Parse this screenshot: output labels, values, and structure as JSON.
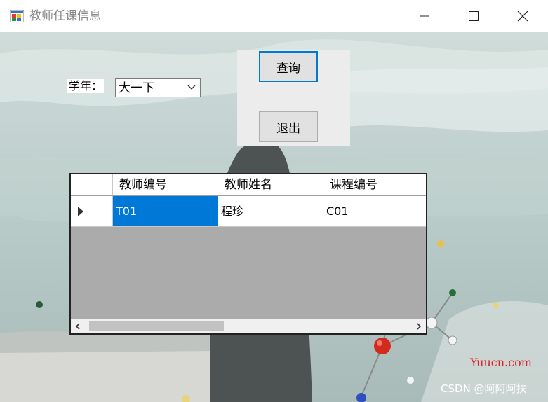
{
  "window": {
    "title": "教师任课信息",
    "icons": {
      "app": "app-window-icon",
      "minimize": "minimize-icon",
      "maximize": "maximize-icon",
      "close": "close-icon"
    }
  },
  "form": {
    "year_label": "学年：",
    "year_combo": {
      "value": "大一下"
    },
    "query_button": "查询",
    "exit_button": "退出"
  },
  "grid": {
    "columns": [
      "教师编号",
      "教师姓名",
      "课程编号"
    ],
    "rows": [
      {
        "teacher_id": "T01",
        "teacher_name": "程珍",
        "course_id": "C01",
        "selected_cell": "teacher_id"
      }
    ],
    "scrollbar": {
      "thumb_position": 0.0
    }
  },
  "watermarks": {
    "site": "Yuucn.com",
    "csdn": "CSDN @阿阿阿扶"
  },
  "colors": {
    "accent": "#0078d7",
    "grid_empty": "#ababab",
    "watermark_red": "#e02020"
  }
}
